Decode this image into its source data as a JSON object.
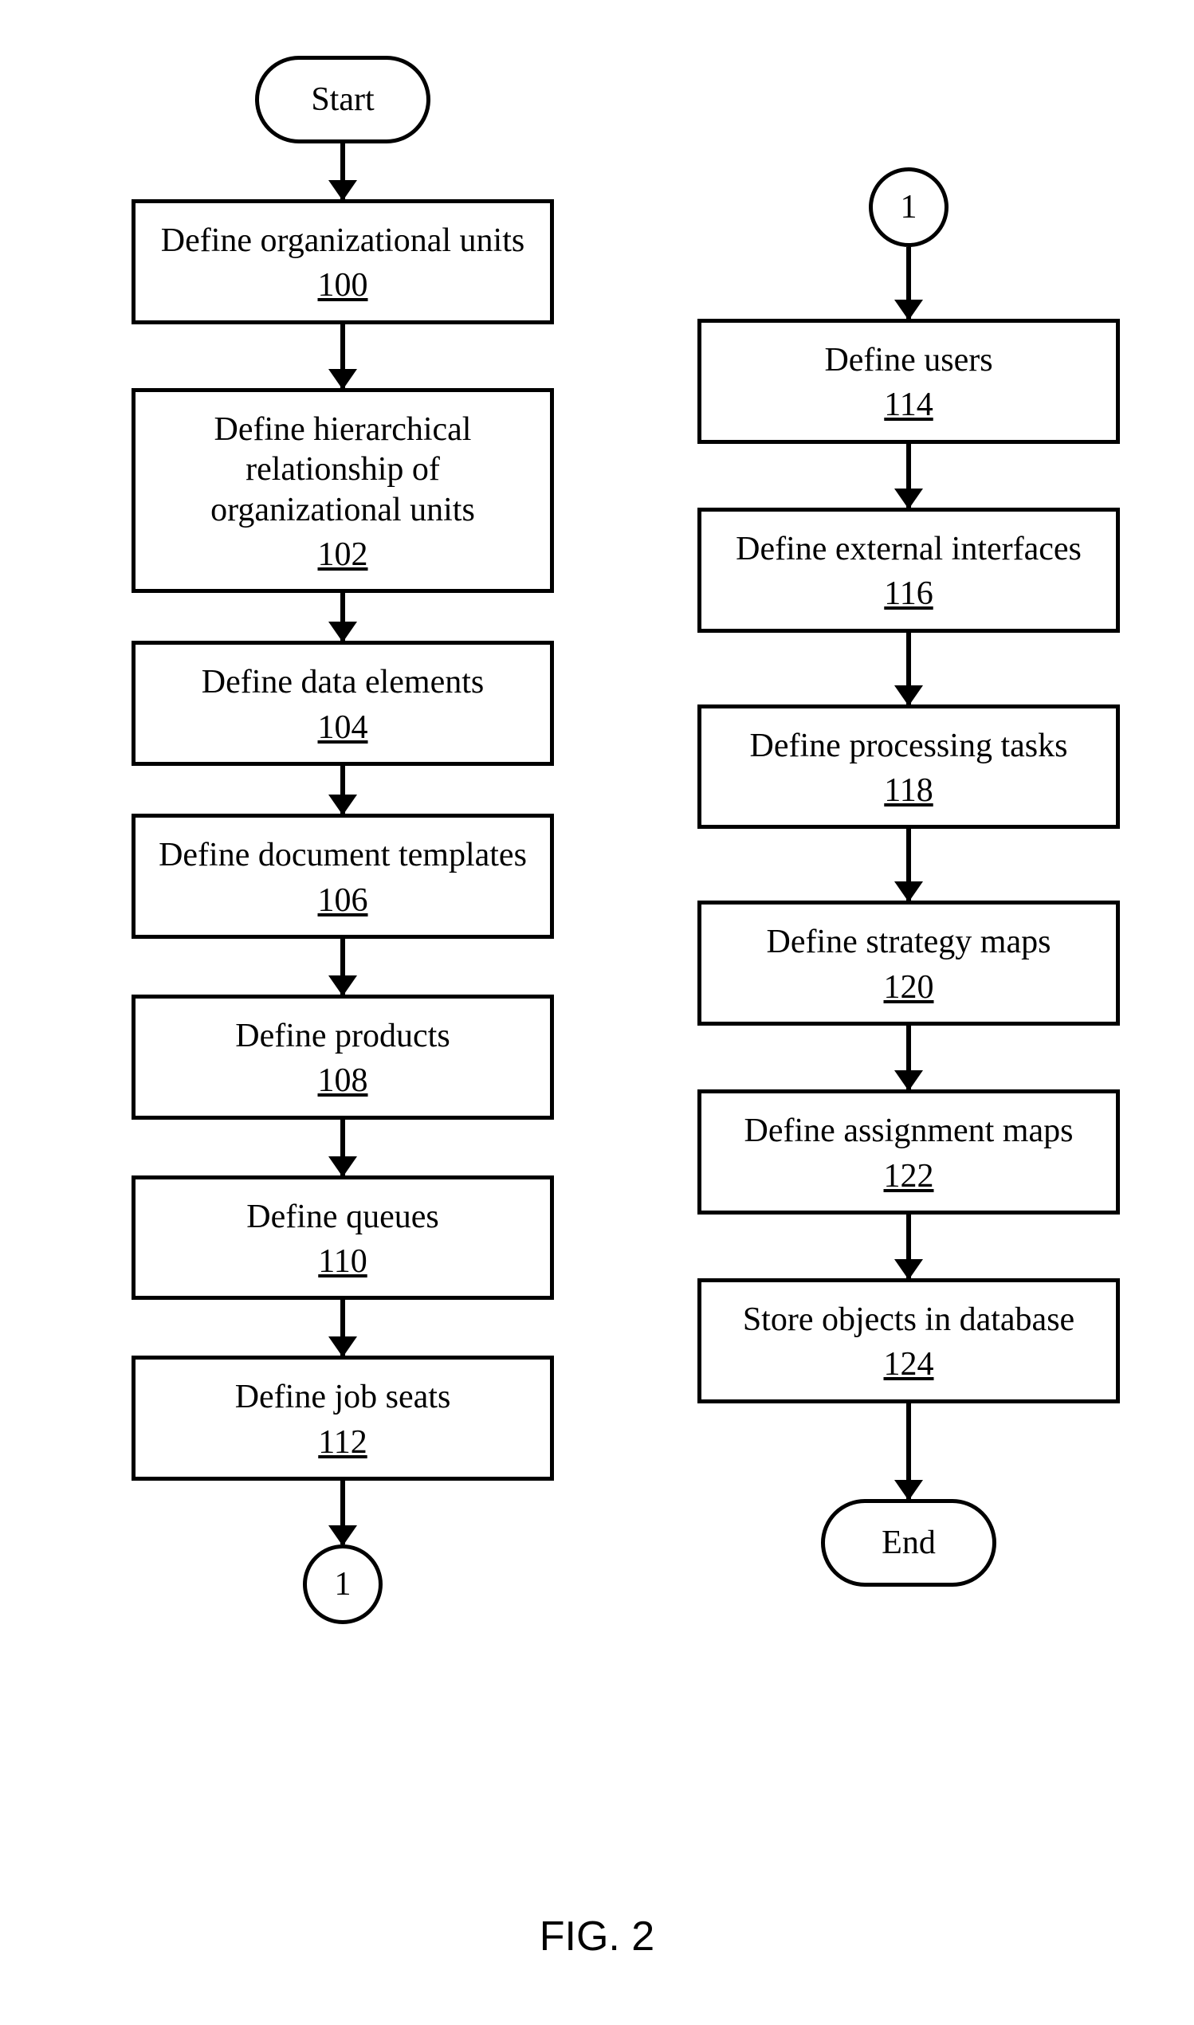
{
  "figure_label": "FIG. 2",
  "terminators": {
    "start": "Start",
    "end": "End"
  },
  "connectors": {
    "one": "1"
  },
  "left_steps": [
    {
      "label": "Define organizational units",
      "ref": "100"
    },
    {
      "label": "Define hierarchical relationship of organizational units",
      "ref": "102"
    },
    {
      "label": "Define data elements",
      "ref": "104"
    },
    {
      "label": "Define document templates",
      "ref": "106"
    },
    {
      "label": "Define products",
      "ref": "108"
    },
    {
      "label": "Define queues",
      "ref": "110"
    },
    {
      "label": "Define job seats",
      "ref": "112"
    }
  ],
  "right_steps": [
    {
      "label": "Define users",
      "ref": "114"
    },
    {
      "label": "Define external interfaces",
      "ref": "116"
    },
    {
      "label": "Define processing tasks",
      "ref": "118"
    },
    {
      "label": "Define strategy maps",
      "ref": "120"
    },
    {
      "label": "Define assignment maps",
      "ref": "122"
    },
    {
      "label": "Store objects in database",
      "ref": "124"
    }
  ]
}
